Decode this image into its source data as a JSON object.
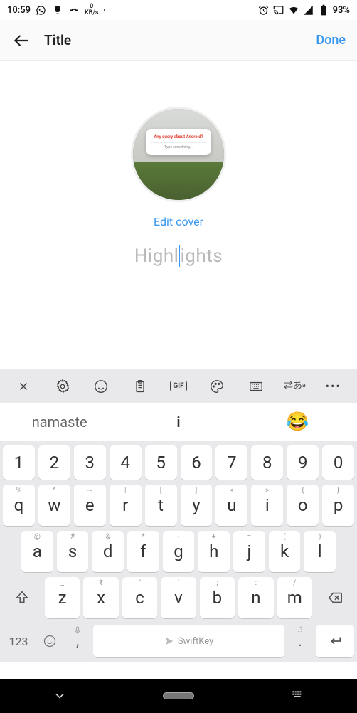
{
  "status": {
    "time": "10:59",
    "kbs_top": "0",
    "kbs_bot": "KB/s",
    "battery": "93%"
  },
  "header": {
    "title": "Title",
    "done": "Done"
  },
  "content": {
    "edit_cover": "Edit cover",
    "placeholder_left": "Highl",
    "placeholder_right": "ights",
    "cover_card_head": "Any query about Android?",
    "cover_card_sub": "Type something..."
  },
  "toolbar": {
    "gif": "GIF"
  },
  "suggestions": {
    "left": "namaste",
    "mid": "i",
    "right": "😂"
  },
  "keyboard": {
    "numRow": [
      "1",
      "2",
      "3",
      "4",
      "5",
      "6",
      "7",
      "8",
      "9",
      "0"
    ],
    "row1": [
      {
        "sec": "%",
        "main": "q"
      },
      {
        "sec": "^",
        "main": "w"
      },
      {
        "sec": "~",
        "main": "e"
      },
      {
        "sec": "|",
        "main": "r"
      },
      {
        "sec": "[",
        "main": "t"
      },
      {
        "sec": "]",
        "main": "y"
      },
      {
        "sec": "<",
        "main": "u"
      },
      {
        "sec": ">",
        "main": "i"
      },
      {
        "sec": "{",
        "main": "o"
      },
      {
        "sec": "}",
        "main": "p"
      }
    ],
    "row2": [
      {
        "sec": "@",
        "main": "a"
      },
      {
        "sec": "#",
        "main": "s"
      },
      {
        "sec": "&",
        "main": "d"
      },
      {
        "sec": "*",
        "main": "f"
      },
      {
        "sec": "-",
        "main": "g"
      },
      {
        "sec": "+",
        "main": "h"
      },
      {
        "sec": "=",
        "main": "j"
      },
      {
        "sec": "(",
        "main": "k"
      },
      {
        "sec": ")",
        "main": "l"
      }
    ],
    "row3": [
      {
        "sec": "_",
        "main": "z"
      },
      {
        "sec": "₹",
        "main": "x"
      },
      {
        "sec": "\"",
        "main": "c"
      },
      {
        "sec": "'",
        "main": "v"
      },
      {
        "sec": ";",
        "main": "b"
      },
      {
        "sec": ":",
        "main": "n"
      },
      {
        "sec": "/",
        "main": "m"
      }
    ],
    "label123": "123",
    "comma": ",",
    "space": "SwiftKey",
    "period": ".",
    "commaSec": "",
    "periodSec": ".?"
  }
}
